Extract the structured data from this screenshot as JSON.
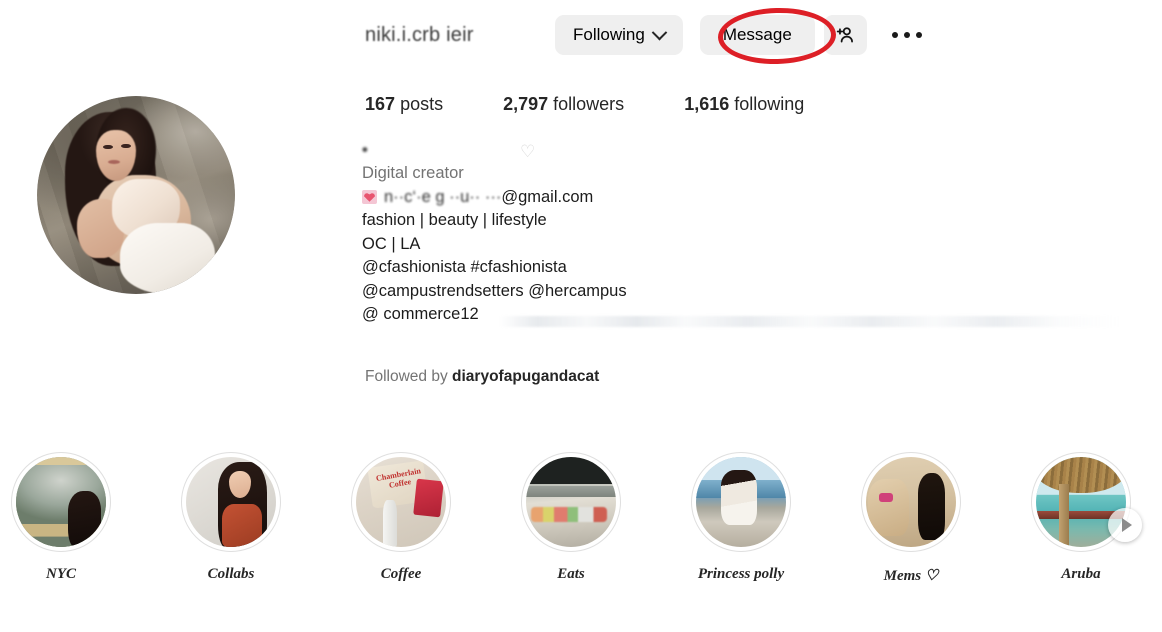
{
  "profile": {
    "username": "niki.i.crb ieir",
    "username_redacted": true,
    "display_name": "•                 ",
    "display_name_heart": "♡",
    "category": "Digital creator",
    "email_emoji": "heart-emoji",
    "email_handle": "n··c‘·e g ··u·· ···",
    "email_domain": "@gmail.com",
    "bio_lines": [
      "fashion | beauty | lifestyle",
      "OC | LA",
      "@cfashionista #cfashionista",
      "@campustrendsetters @hercampus",
      "@  commerce12"
    ],
    "followed_by_prefix": "Followed by ",
    "followed_by_name": "diaryofapugandacat",
    "avatar_alt": "profile-photo"
  },
  "stats": [
    {
      "value": "167",
      "label": "posts"
    },
    {
      "value": "2,797",
      "label": "followers"
    },
    {
      "value": "1,616",
      "label": "following"
    }
  ],
  "actions": {
    "following_label": "Following",
    "following_chevron": "chevron-down-icon",
    "message_label": "Message",
    "add_user_icon": "add-person-icon",
    "more_icon": "more-options-icon"
  },
  "annotation": {
    "shape": "ellipse",
    "color": "#dd1f26",
    "target": "Message"
  },
  "highlights": [
    {
      "label": "NYC",
      "art": "t-nyc"
    },
    {
      "label": "Collabs",
      "art": "t-collabs"
    },
    {
      "label": "Coffee",
      "art": "t-coffee",
      "overlay_text": "Chamberlain Coffee"
    },
    {
      "label": "Eats",
      "art": "t-eats"
    },
    {
      "label": "Princess polly",
      "art": "t-pp"
    },
    {
      "label": "Mems ♡",
      "art": "t-mems"
    },
    {
      "label": "Aruba",
      "art": "t-aruba"
    }
  ],
  "carousel": {
    "next_icon": "chevron-right-icon"
  },
  "colors": {
    "button_bg": "#efefef",
    "text_primary": "#262626",
    "text_secondary": "#737373",
    "annotation_red": "#dd1f26",
    "ring": "#dfdfdf"
  }
}
